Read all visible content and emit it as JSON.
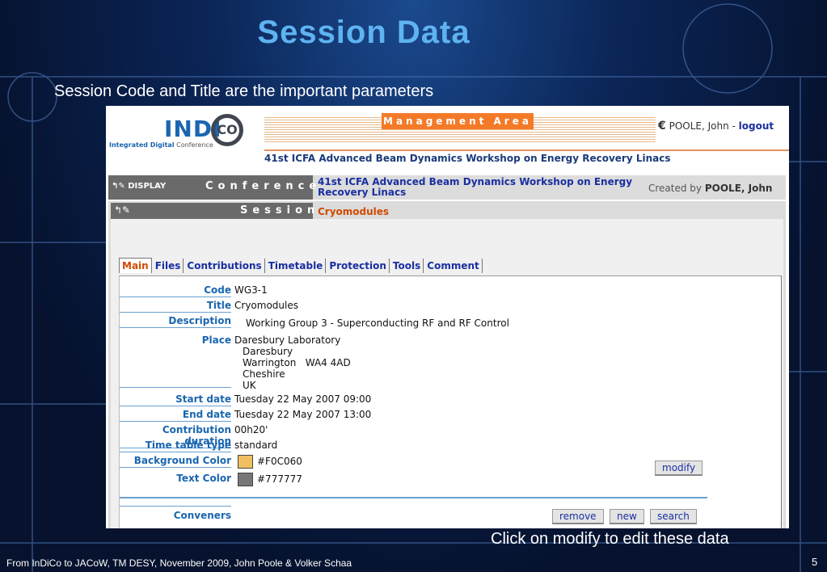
{
  "slide": {
    "title": "Session Data",
    "subtitle": "Session Code and Title are the important parameters",
    "note": "Click on modify to edit these data",
    "footer": "From InDiCo to JACoW, TM  DESY, November 2009, John Poole & Volker Schaa",
    "page_number": "5"
  },
  "app": {
    "logo": "INDI",
    "logo_co": "CO",
    "logo_sub_blue": "Integrated Digital",
    "logo_sub_rest": " Conference",
    "management_area": "Management Area",
    "user_cc": "€",
    "user_name": "POOLE, John - ",
    "logout": "logout",
    "conference_name": "41st ICFA Advanced Beam Dynamics Workshop on Energy Recovery Linacs"
  },
  "conference_bar": {
    "display": "DISPLAY",
    "label": "Conference",
    "title": "41st ICFA Advanced Beam Dynamics Workshop on Energy Recovery Linacs",
    "created_by": "Created by ",
    "creator": "POOLE, John"
  },
  "session_bar": {
    "label": "Session",
    "name": "Cryomodules"
  },
  "tabs": [
    "Main",
    "Files",
    "Contributions",
    "Timetable",
    "Protection",
    "Tools",
    "Comment"
  ],
  "fields": {
    "code_label": "Code",
    "code": "WG3-1",
    "title_label": "Title",
    "title": "Cryomodules",
    "description_label": "Description",
    "description": "Working Group 3 - Superconducting RF and RF Control",
    "place_label": "Place",
    "place": "Daresbury Laboratory",
    "address_1": "Daresbury",
    "address_2": "Warrington   WA4 4AD",
    "address_3": "Cheshire",
    "address_4": "UK",
    "start_label": "Start date",
    "start": "Tuesday 22 May 2007 09:00",
    "end_label": "End date",
    "end": "Tuesday 22 May 2007 13:00",
    "duration_label": "Contribution duration",
    "duration": "00h20'",
    "tt_type_label": "Time table type",
    "tt_type": "standard",
    "bg_color_label": "Background Color",
    "bg_color": "#F0C060",
    "text_color_label": "Text Color",
    "text_color": "#777777",
    "conveners_label": "Conveners"
  },
  "buttons": {
    "modify": "modify",
    "remove": "remove",
    "new": "new",
    "search": "search"
  },
  "colors": {
    "accent": "#f47a28",
    "link": "#1a2fa0",
    "bg_swatch": "#F0C060",
    "text_swatch": "#777777"
  }
}
